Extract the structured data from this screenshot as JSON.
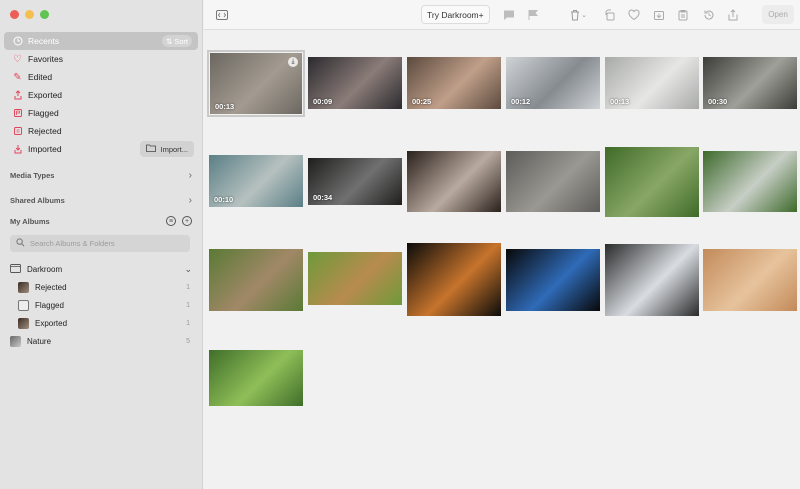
{
  "sidebar": {
    "items": [
      {
        "label": "Recents",
        "icon": "clock-icon"
      },
      {
        "label": "Favorites",
        "icon": "heart-icon"
      },
      {
        "label": "Edited",
        "icon": "pencil-icon"
      },
      {
        "label": "Exported",
        "icon": "export-icon"
      },
      {
        "label": "Flagged",
        "icon": "flag-icon"
      },
      {
        "label": "Rejected",
        "icon": "reject-icon"
      },
      {
        "label": "Imported",
        "icon": "import-icon"
      }
    ],
    "sort_label": "Sort",
    "import_label": "Import...",
    "media_types": "Media Types",
    "shared_albums": "Shared Albums",
    "my_albums": "My Albums",
    "search_placeholder": "Search Albums & Folders",
    "folder": {
      "label": "Darkroom"
    },
    "albums": [
      {
        "label": "Rejected",
        "count": "1"
      },
      {
        "label": "Flagged",
        "count": "1"
      },
      {
        "label": "Exported",
        "count": "1"
      },
      {
        "label": "Nature",
        "count": "5"
      }
    ]
  },
  "toolbar": {
    "try_label": "Try Darkroom+",
    "open_label": "Open"
  },
  "grid": {
    "tiles": [
      {
        "duration": "00:13",
        "colors": [
          "#6b6760",
          "#a39b91"
        ],
        "subject": "woman-in-car-photo"
      },
      {
        "duration": "00:09",
        "colors": [
          "#2c2a2f",
          "#8a7c78"
        ],
        "subject": "woman-on-phone-photo"
      },
      {
        "duration": "00:25",
        "colors": [
          "#5b4a3e",
          "#c09f89"
        ],
        "subject": "laptop-hands-photo"
      },
      {
        "duration": "00:12",
        "colors": [
          "#cfd3d6",
          "#868b90"
        ],
        "subject": "misty-street-photo"
      },
      {
        "duration": "00:13",
        "colors": [
          "#a8aaa8",
          "#e6e6e5"
        ],
        "subject": "crowd-aerial-photo"
      },
      {
        "duration": "00:30",
        "colors": [
          "#3c3c38",
          "#a0a09a"
        ],
        "subject": "swing-photo"
      },
      {
        "duration": "00:10",
        "colors": [
          "#5a7f86",
          "#b6c1bf"
        ],
        "subject": "woman-window-photo"
      },
      {
        "duration": "00:34",
        "colors": [
          "#1e1e1d",
          "#707070"
        ],
        "subject": "dark-room-photo"
      },
      {
        "duration": "",
        "colors": [
          "#2a211b",
          "#b9aaa0"
        ],
        "subject": "raccoon-photo"
      },
      {
        "duration": "",
        "colors": [
          "#5d5c59",
          "#9a9892"
        ],
        "subject": "bird-on-rock-photo"
      },
      {
        "duration": "",
        "colors": [
          "#3f6a28",
          "#88a766"
        ],
        "subject": "goat-grass-photo"
      },
      {
        "duration": "",
        "colors": [
          "#3d6a2b",
          "#c8cec6"
        ],
        "subject": "cat-photo"
      },
      {
        "duration": "",
        "colors": [
          "#5a7a35",
          "#a18867"
        ],
        "subject": "donkey-photo"
      },
      {
        "duration": "",
        "colors": [
          "#6e9a3a",
          "#b88b4e"
        ],
        "subject": "antelope-photo"
      },
      {
        "duration": "",
        "colors": [
          "#0b0b0a",
          "#c7742c"
        ],
        "subject": "tiger-photo"
      },
      {
        "duration": "",
        "colors": [
          "#080808",
          "#2f6bb8"
        ],
        "subject": "lorikeets-photo"
      },
      {
        "duration": "",
        "colors": [
          "#2a2a2a",
          "#d9dde2"
        ],
        "subject": "penguins-photo"
      },
      {
        "duration": "",
        "colors": [
          "#c28a5a",
          "#e7c39c"
        ],
        "subject": "elephants-photo"
      },
      {
        "duration": "",
        "colors": [
          "#3f6e2a",
          "#8fbe58"
        ],
        "subject": "zebra-photo"
      }
    ]
  },
  "colors": {
    "accent": "#e0475c",
    "active_bg": "#c4c4c4"
  }
}
